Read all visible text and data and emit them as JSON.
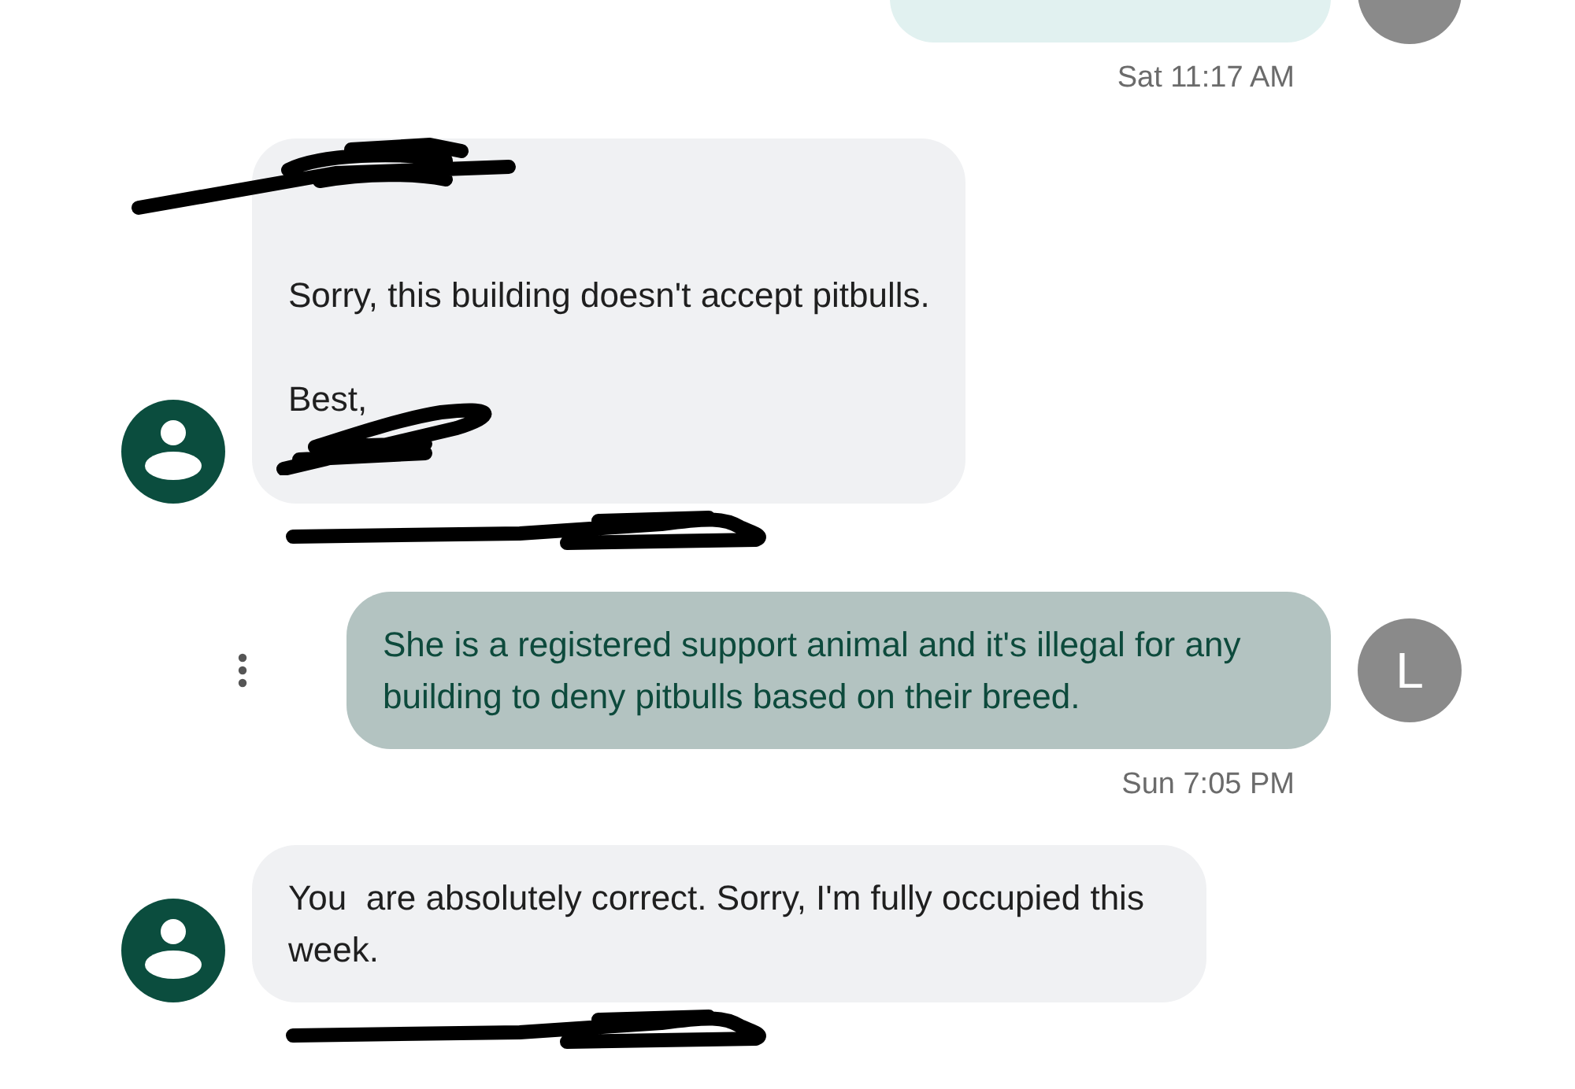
{
  "conversation": [
    {
      "kind": "outgoing-cut",
      "timestamp": "Sat 11:17 AM"
    },
    {
      "kind": "incoming",
      "lines": [
        {
          "kind": "redacted"
        },
        {
          "kind": "blank"
        },
        {
          "kind": "text",
          "text": "Sorry, this building doesn't accept pitbulls."
        },
        {
          "kind": "blank"
        },
        {
          "kind": "text",
          "text": "Best,"
        },
        {
          "kind": "redacted"
        }
      ],
      "timestamp_redacted": true
    },
    {
      "kind": "outgoing",
      "text": "She is a registered support animal and it's illegal for any building to deny pitbulls based on their breed.",
      "avatar": "L",
      "timestamp": "Sun 7:05 PM"
    },
    {
      "kind": "incoming",
      "lines": [
        {
          "kind": "text",
          "text": "You  are absolutely correct. Sorry, I'm fully occupied this week."
        }
      ],
      "timestamp_redacted": true
    }
  ]
}
